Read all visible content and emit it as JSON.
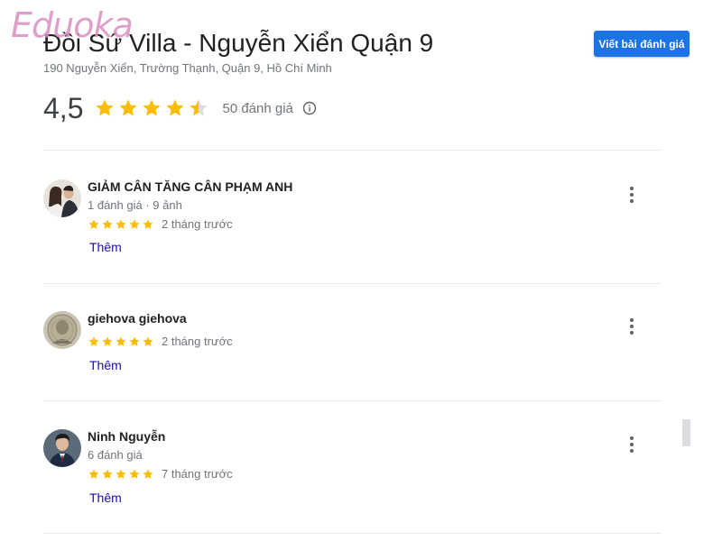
{
  "watermark": "Eduoka",
  "place": {
    "title": "Đồi Sứ Villa - Nguyễn Xiển Quận 9",
    "address": "190 Nguyễn Xiển, Trường Thạnh, Quận 9, Hồ Chí Minh"
  },
  "actions": {
    "write_review_label": "Viết bài đánh giá"
  },
  "summary": {
    "rating_text": "4,5",
    "rating_value": 4.5,
    "review_count_label": "50 đánh giá",
    "info_icon": "info-icon"
  },
  "colors": {
    "star": "#fbbc04",
    "star_empty": "#dadce0",
    "button": "#1a73e8",
    "link": "#1a0dab"
  },
  "reviews": [
    {
      "name": "GIẢM CÂN TĂNG CÂN PHẠM ANH",
      "meta": "1 đánh giá · 9 ảnh",
      "stars": 5,
      "time": "2 tháng trước",
      "more_label": "Thêm",
      "avatar": "couple-photo-avatar"
    },
    {
      "name": "giehova giehova",
      "meta": "",
      "stars": 5,
      "time": "2 tháng trước",
      "more_label": "Thêm",
      "avatar": "banknote-avatar"
    },
    {
      "name": "Ninh Nguyễn",
      "meta": "6 đánh giá",
      "stars": 5,
      "time": "7 tháng trước",
      "more_label": "Thêm",
      "avatar": "man-photo-avatar"
    }
  ]
}
